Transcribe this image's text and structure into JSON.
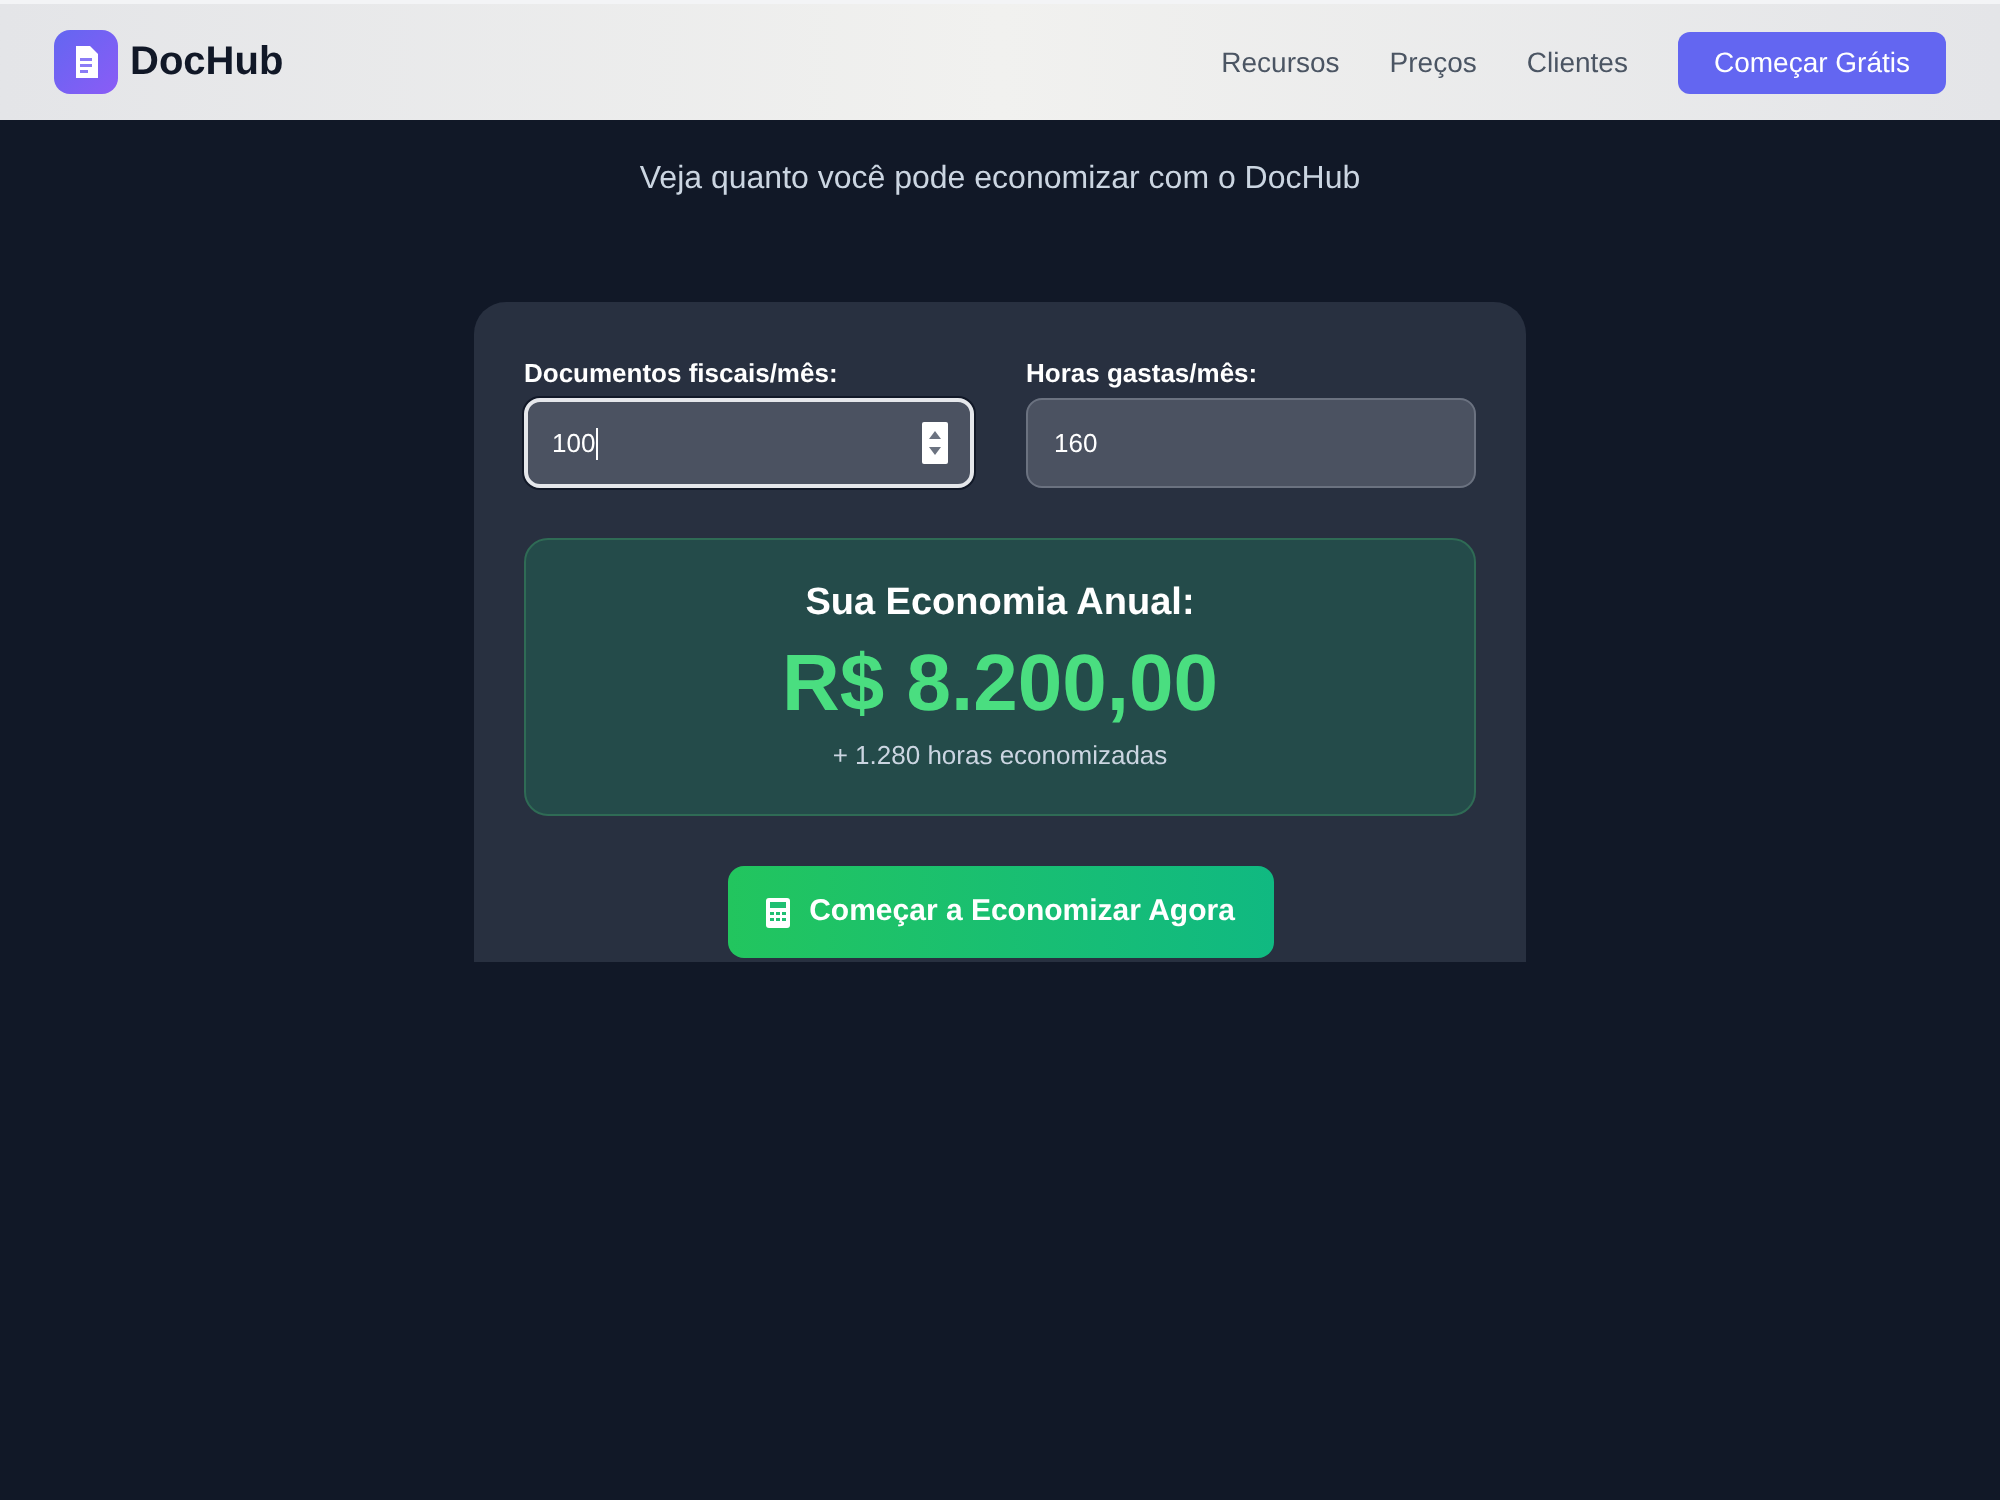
{
  "header": {
    "logo_text": "DocHub",
    "nav_links": [
      "Recursos",
      "Preços",
      "Clientes"
    ],
    "cta_button": "Começar Grátis"
  },
  "subtitle": "Veja quanto você pode economizar com o DocHub",
  "calculator": {
    "fields": [
      {
        "label": "Documentos fiscais/mês:",
        "value": "100",
        "focused": true
      },
      {
        "label": "Horas gastas/mês:",
        "value": "160",
        "focused": false
      }
    ],
    "result": {
      "title": "Sua Economia Anual:",
      "amount": "R$ 8.200,00",
      "hours": "+ 1.280 horas economizadas"
    },
    "button": "Começar a Economizar Agora"
  }
}
